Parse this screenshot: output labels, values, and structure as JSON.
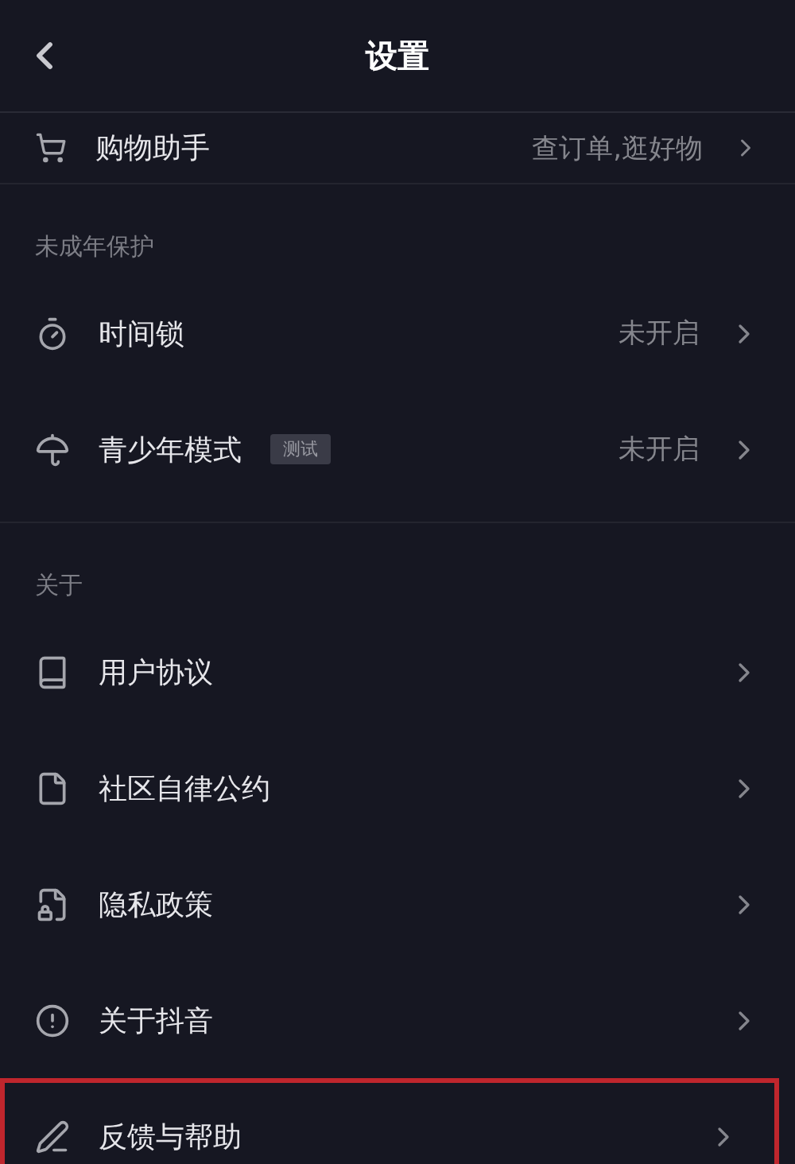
{
  "header": {
    "title": "设置"
  },
  "partial_row": {
    "label": "购物助手",
    "value": "查订单,逛好物"
  },
  "sections": [
    {
      "title": "未成年保护",
      "items": [
        {
          "label": "时间锁",
          "value": "未开启",
          "highlighted": false
        },
        {
          "label": "青少年模式",
          "badge": "测试",
          "value": "未开启",
          "highlighted": false
        }
      ]
    },
    {
      "title": "关于",
      "items": [
        {
          "label": "用户协议",
          "highlighted": false
        },
        {
          "label": "社区自律公约",
          "highlighted": false
        },
        {
          "label": "隐私政策",
          "highlighted": false
        },
        {
          "label": "关于抖音",
          "highlighted": false
        },
        {
          "label": "反馈与帮助",
          "highlighted": true
        }
      ]
    }
  ]
}
